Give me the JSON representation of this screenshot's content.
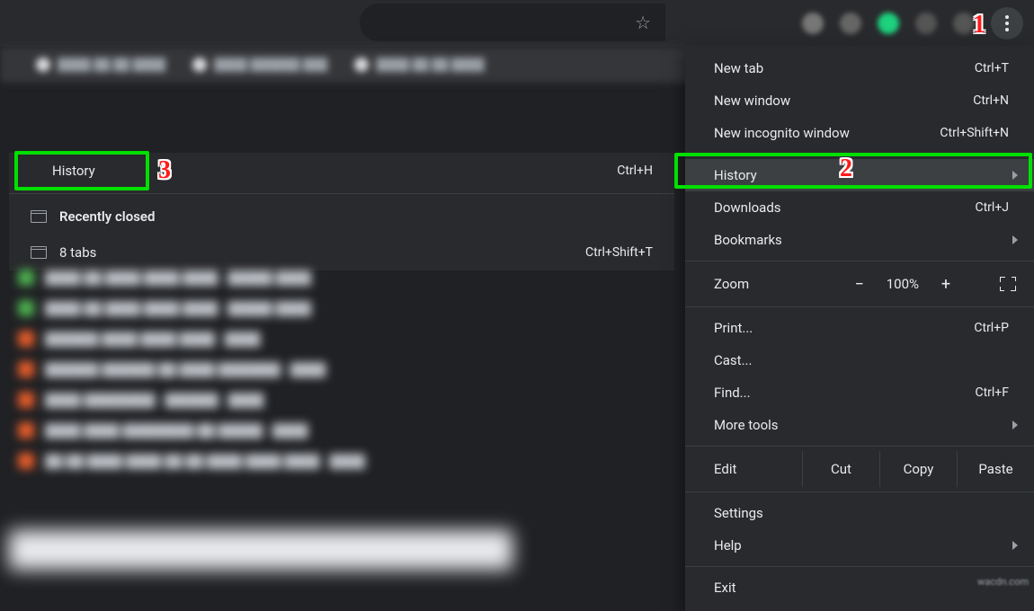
{
  "submenu": {
    "history_label": "History",
    "history_shortcut": "Ctrl+H",
    "recently_closed": "Recently closed",
    "tabs_label": "8 tabs",
    "tabs_shortcut": "Ctrl+Shift+T"
  },
  "menu": {
    "new_tab": {
      "label": "New tab",
      "shortcut": "Ctrl+T"
    },
    "new_window": {
      "label": "New window",
      "shortcut": "Ctrl+N"
    },
    "incognito": {
      "label": "New incognito window",
      "shortcut": "Ctrl+Shift+N"
    },
    "history": {
      "label": "History"
    },
    "downloads": {
      "label": "Downloads",
      "shortcut": "Ctrl+J"
    },
    "bookmarks": {
      "label": "Bookmarks"
    },
    "zoom": {
      "label": "Zoom",
      "level": "100%",
      "minus": "−",
      "plus": "+"
    },
    "print": {
      "label": "Print...",
      "shortcut": "Ctrl+P"
    },
    "cast": {
      "label": "Cast..."
    },
    "find": {
      "label": "Find...",
      "shortcut": "Ctrl+F"
    },
    "more_tools": {
      "label": "More tools"
    },
    "edit": {
      "label": "Edit",
      "cut": "Cut",
      "copy": "Copy",
      "paste": "Paste"
    },
    "settings": {
      "label": "Settings"
    },
    "help": {
      "label": "Help"
    },
    "exit": {
      "label": "Exit"
    }
  },
  "annotations": {
    "n1": "1",
    "n2": "2",
    "n3": "3"
  },
  "watermark": "wacdn.com"
}
